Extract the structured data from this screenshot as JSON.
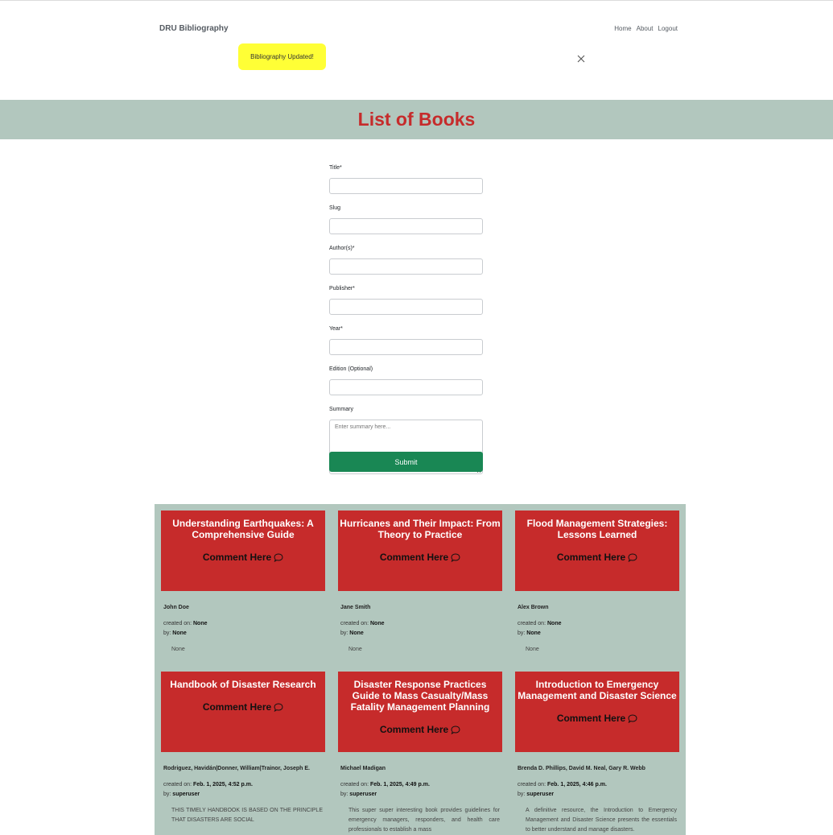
{
  "nav": {
    "brand": "DRU Bibliography",
    "links": [
      "Home",
      "About",
      "Logout"
    ]
  },
  "alert": {
    "message": "Bibliography Updated!"
  },
  "page_title": "List of Books",
  "form": {
    "title_label": "Title*",
    "slug_label": "Slug",
    "authors_label": "Author(s)*",
    "publisher_label": "Publisher*",
    "year_label": "Year*",
    "edition_label": "Edition (Optional)",
    "summary_label": "Summary",
    "summary_placeholder": "Enter summary here...",
    "submit_label": "Submit"
  },
  "books": [
    {
      "title": "Understanding Earthquakes: A Comprehensive Guide",
      "comment_label": "Comment Here",
      "author": "John Doe",
      "created_label": "created on:",
      "created_value": "None",
      "by_label": "by:",
      "by_value": "None",
      "summary": "None"
    },
    {
      "title": "Hurricanes and Their Impact: From Theory to Practice",
      "comment_label": "Comment Here",
      "author": "Jane Smith",
      "created_label": "created on:",
      "created_value": "None",
      "by_label": "by:",
      "by_value": "None",
      "summary": "None"
    },
    {
      "title": "Flood Management Strategies: Lessons Learned",
      "comment_label": "Comment Here",
      "author": "Alex Brown",
      "created_label": "created on:",
      "created_value": "None",
      "by_label": "by:",
      "by_value": "None",
      "summary": "None"
    },
    {
      "title": "Handbook of Disaster Research",
      "comment_label": "Comment Here",
      "author": "Rodriguez, Havidán|Donner, William|Trainor, Joseph E.",
      "created_label": "created on:",
      "created_value": "Feb. 1, 2025, 4:52 p.m.",
      "by_label": "by:",
      "by_value": "superuser",
      "summary": "THIS TIMELY HANDBOOK IS BASED ON THE PRINCIPLE THAT DISASTERS ARE SOCIAL"
    },
    {
      "title": "Disaster Response Practices Guide to Mass Casualty/Mass Fatality Management Planning",
      "comment_label": "Comment Here",
      "author": "Michael Madigan",
      "created_label": "created on:",
      "created_value": "Feb. 1, 2025, 4:49 p.m.",
      "by_label": "by:",
      "by_value": "superuser",
      "summary": "This super super interesting book provides guidelines for emergency managers, responders, and health care professionals to establish a mass"
    },
    {
      "title": "Introduction to Emergency Management and Disaster Science",
      "comment_label": "Comment Here",
      "author": "Brenda D. Phillips, David M. Neal, Gary R. Webb",
      "created_label": "created on:",
      "created_value": "Feb. 1, 2025, 4:46 p.m.",
      "by_label": "by:",
      "by_value": "superuser",
      "summary": "A definitive resource, the Introduction to Emergency Management and Disaster Science presents the essentials to better understand and manage disasters."
    }
  ],
  "icons": {
    "comment": "speech-bubble-icon",
    "close": "close-icon"
  },
  "colors": {
    "accent_red": "#c62b2b",
    "sage": "#b2c7be",
    "highlight": "#ffff36",
    "submit_green": "#198754"
  }
}
